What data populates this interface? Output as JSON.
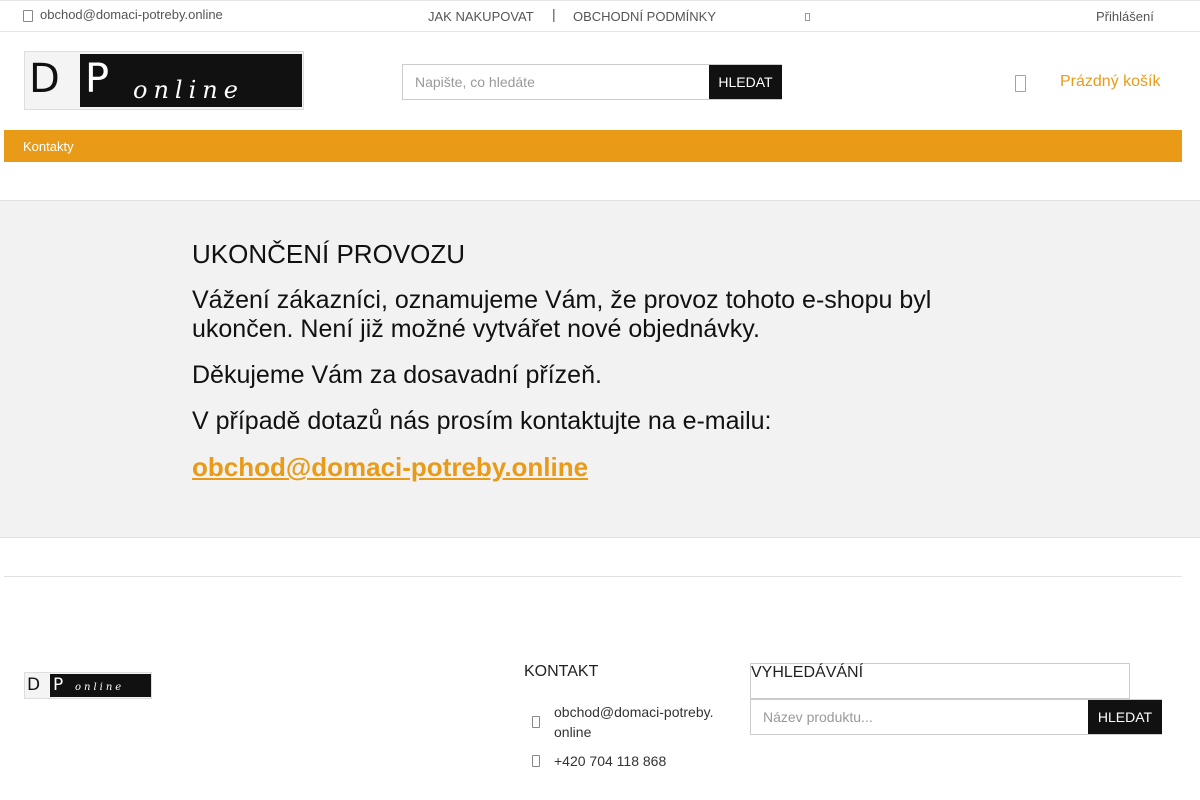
{
  "topbar": {
    "email": "obchod@domaci-potreby.online",
    "nav_how_to_buy": "JAK NAKUPOVAT",
    "separator": "|",
    "nav_terms": "OBCHODNÍ PODMÍNKY",
    "login": "Přihlášení"
  },
  "header": {
    "logo_letter_d": "D",
    "logo_letter_p": "P",
    "logo_online": "online",
    "search_placeholder": "Napište, co hledáte",
    "search_button": "HLEDAT",
    "cart_label": "Prázdný košík"
  },
  "menu": {
    "items": [
      "Kontakty"
    ]
  },
  "main": {
    "heading": "UKONČENÍ PROVOZU",
    "paragraph1": "Vážení zákazníci, oznamujeme Vám, že provoz tohoto e-shopu byl ukončen. Není již možné vytvářet nové objednávky.",
    "paragraph2": "Děkujeme Vám za dosavadní přízeň.",
    "paragraph3": "V případě dotazů nás prosím kontaktujte na e-mailu:",
    "email_link": "obchod@domaci-potreby.online"
  },
  "footer": {
    "logo_letter_d": "D",
    "logo_letter_p": "P",
    "logo_online": "online",
    "contact_heading": "KONTAKT",
    "contact_email": "obchod@domaci-potreby.online",
    "contact_phone": "+420 704 118 868",
    "search_heading": "VYHLEDÁVÁNÍ",
    "search_placeholder": "Název produktu...",
    "search_button": "HLEDAT"
  },
  "colors": {
    "accent": "#e99b18",
    "dark": "#111111"
  },
  "icons": [
    "envelope-icon",
    "square-icon",
    "cart-icon",
    "contact-envelope-icon",
    "phone-icon"
  ]
}
